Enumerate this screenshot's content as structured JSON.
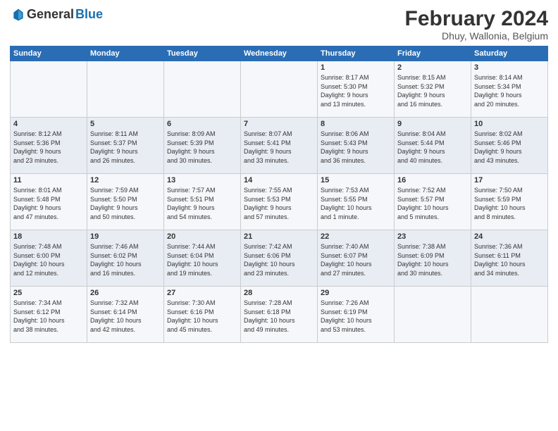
{
  "logo": {
    "text1": "General",
    "text2": "Blue"
  },
  "title": "February 2024",
  "subtitle": "Dhuy, Wallonia, Belgium",
  "weekdays": [
    "Sunday",
    "Monday",
    "Tuesday",
    "Wednesday",
    "Thursday",
    "Friday",
    "Saturday"
  ],
  "weeks": [
    [
      {
        "day": "",
        "info": ""
      },
      {
        "day": "",
        "info": ""
      },
      {
        "day": "",
        "info": ""
      },
      {
        "day": "",
        "info": ""
      },
      {
        "day": "1",
        "info": "Sunrise: 8:17 AM\nSunset: 5:30 PM\nDaylight: 9 hours\nand 13 minutes."
      },
      {
        "day": "2",
        "info": "Sunrise: 8:15 AM\nSunset: 5:32 PM\nDaylight: 9 hours\nand 16 minutes."
      },
      {
        "day": "3",
        "info": "Sunrise: 8:14 AM\nSunset: 5:34 PM\nDaylight: 9 hours\nand 20 minutes."
      }
    ],
    [
      {
        "day": "4",
        "info": "Sunrise: 8:12 AM\nSunset: 5:36 PM\nDaylight: 9 hours\nand 23 minutes."
      },
      {
        "day": "5",
        "info": "Sunrise: 8:11 AM\nSunset: 5:37 PM\nDaylight: 9 hours\nand 26 minutes."
      },
      {
        "day": "6",
        "info": "Sunrise: 8:09 AM\nSunset: 5:39 PM\nDaylight: 9 hours\nand 30 minutes."
      },
      {
        "day": "7",
        "info": "Sunrise: 8:07 AM\nSunset: 5:41 PM\nDaylight: 9 hours\nand 33 minutes."
      },
      {
        "day": "8",
        "info": "Sunrise: 8:06 AM\nSunset: 5:43 PM\nDaylight: 9 hours\nand 36 minutes."
      },
      {
        "day": "9",
        "info": "Sunrise: 8:04 AM\nSunset: 5:44 PM\nDaylight: 9 hours\nand 40 minutes."
      },
      {
        "day": "10",
        "info": "Sunrise: 8:02 AM\nSunset: 5:46 PM\nDaylight: 9 hours\nand 43 minutes."
      }
    ],
    [
      {
        "day": "11",
        "info": "Sunrise: 8:01 AM\nSunset: 5:48 PM\nDaylight: 9 hours\nand 47 minutes."
      },
      {
        "day": "12",
        "info": "Sunrise: 7:59 AM\nSunset: 5:50 PM\nDaylight: 9 hours\nand 50 minutes."
      },
      {
        "day": "13",
        "info": "Sunrise: 7:57 AM\nSunset: 5:51 PM\nDaylight: 9 hours\nand 54 minutes."
      },
      {
        "day": "14",
        "info": "Sunrise: 7:55 AM\nSunset: 5:53 PM\nDaylight: 9 hours\nand 57 minutes."
      },
      {
        "day": "15",
        "info": "Sunrise: 7:53 AM\nSunset: 5:55 PM\nDaylight: 10 hours\nand 1 minute."
      },
      {
        "day": "16",
        "info": "Sunrise: 7:52 AM\nSunset: 5:57 PM\nDaylight: 10 hours\nand 5 minutes."
      },
      {
        "day": "17",
        "info": "Sunrise: 7:50 AM\nSunset: 5:59 PM\nDaylight: 10 hours\nand 8 minutes."
      }
    ],
    [
      {
        "day": "18",
        "info": "Sunrise: 7:48 AM\nSunset: 6:00 PM\nDaylight: 10 hours\nand 12 minutes."
      },
      {
        "day": "19",
        "info": "Sunrise: 7:46 AM\nSunset: 6:02 PM\nDaylight: 10 hours\nand 16 minutes."
      },
      {
        "day": "20",
        "info": "Sunrise: 7:44 AM\nSunset: 6:04 PM\nDaylight: 10 hours\nand 19 minutes."
      },
      {
        "day": "21",
        "info": "Sunrise: 7:42 AM\nSunset: 6:06 PM\nDaylight: 10 hours\nand 23 minutes."
      },
      {
        "day": "22",
        "info": "Sunrise: 7:40 AM\nSunset: 6:07 PM\nDaylight: 10 hours\nand 27 minutes."
      },
      {
        "day": "23",
        "info": "Sunrise: 7:38 AM\nSunset: 6:09 PM\nDaylight: 10 hours\nand 30 minutes."
      },
      {
        "day": "24",
        "info": "Sunrise: 7:36 AM\nSunset: 6:11 PM\nDaylight: 10 hours\nand 34 minutes."
      }
    ],
    [
      {
        "day": "25",
        "info": "Sunrise: 7:34 AM\nSunset: 6:12 PM\nDaylight: 10 hours\nand 38 minutes."
      },
      {
        "day": "26",
        "info": "Sunrise: 7:32 AM\nSunset: 6:14 PM\nDaylight: 10 hours\nand 42 minutes."
      },
      {
        "day": "27",
        "info": "Sunrise: 7:30 AM\nSunset: 6:16 PM\nDaylight: 10 hours\nand 45 minutes."
      },
      {
        "day": "28",
        "info": "Sunrise: 7:28 AM\nSunset: 6:18 PM\nDaylight: 10 hours\nand 49 minutes."
      },
      {
        "day": "29",
        "info": "Sunrise: 7:26 AM\nSunset: 6:19 PM\nDaylight: 10 hours\nand 53 minutes."
      },
      {
        "day": "",
        "info": ""
      },
      {
        "day": "",
        "info": ""
      }
    ]
  ]
}
